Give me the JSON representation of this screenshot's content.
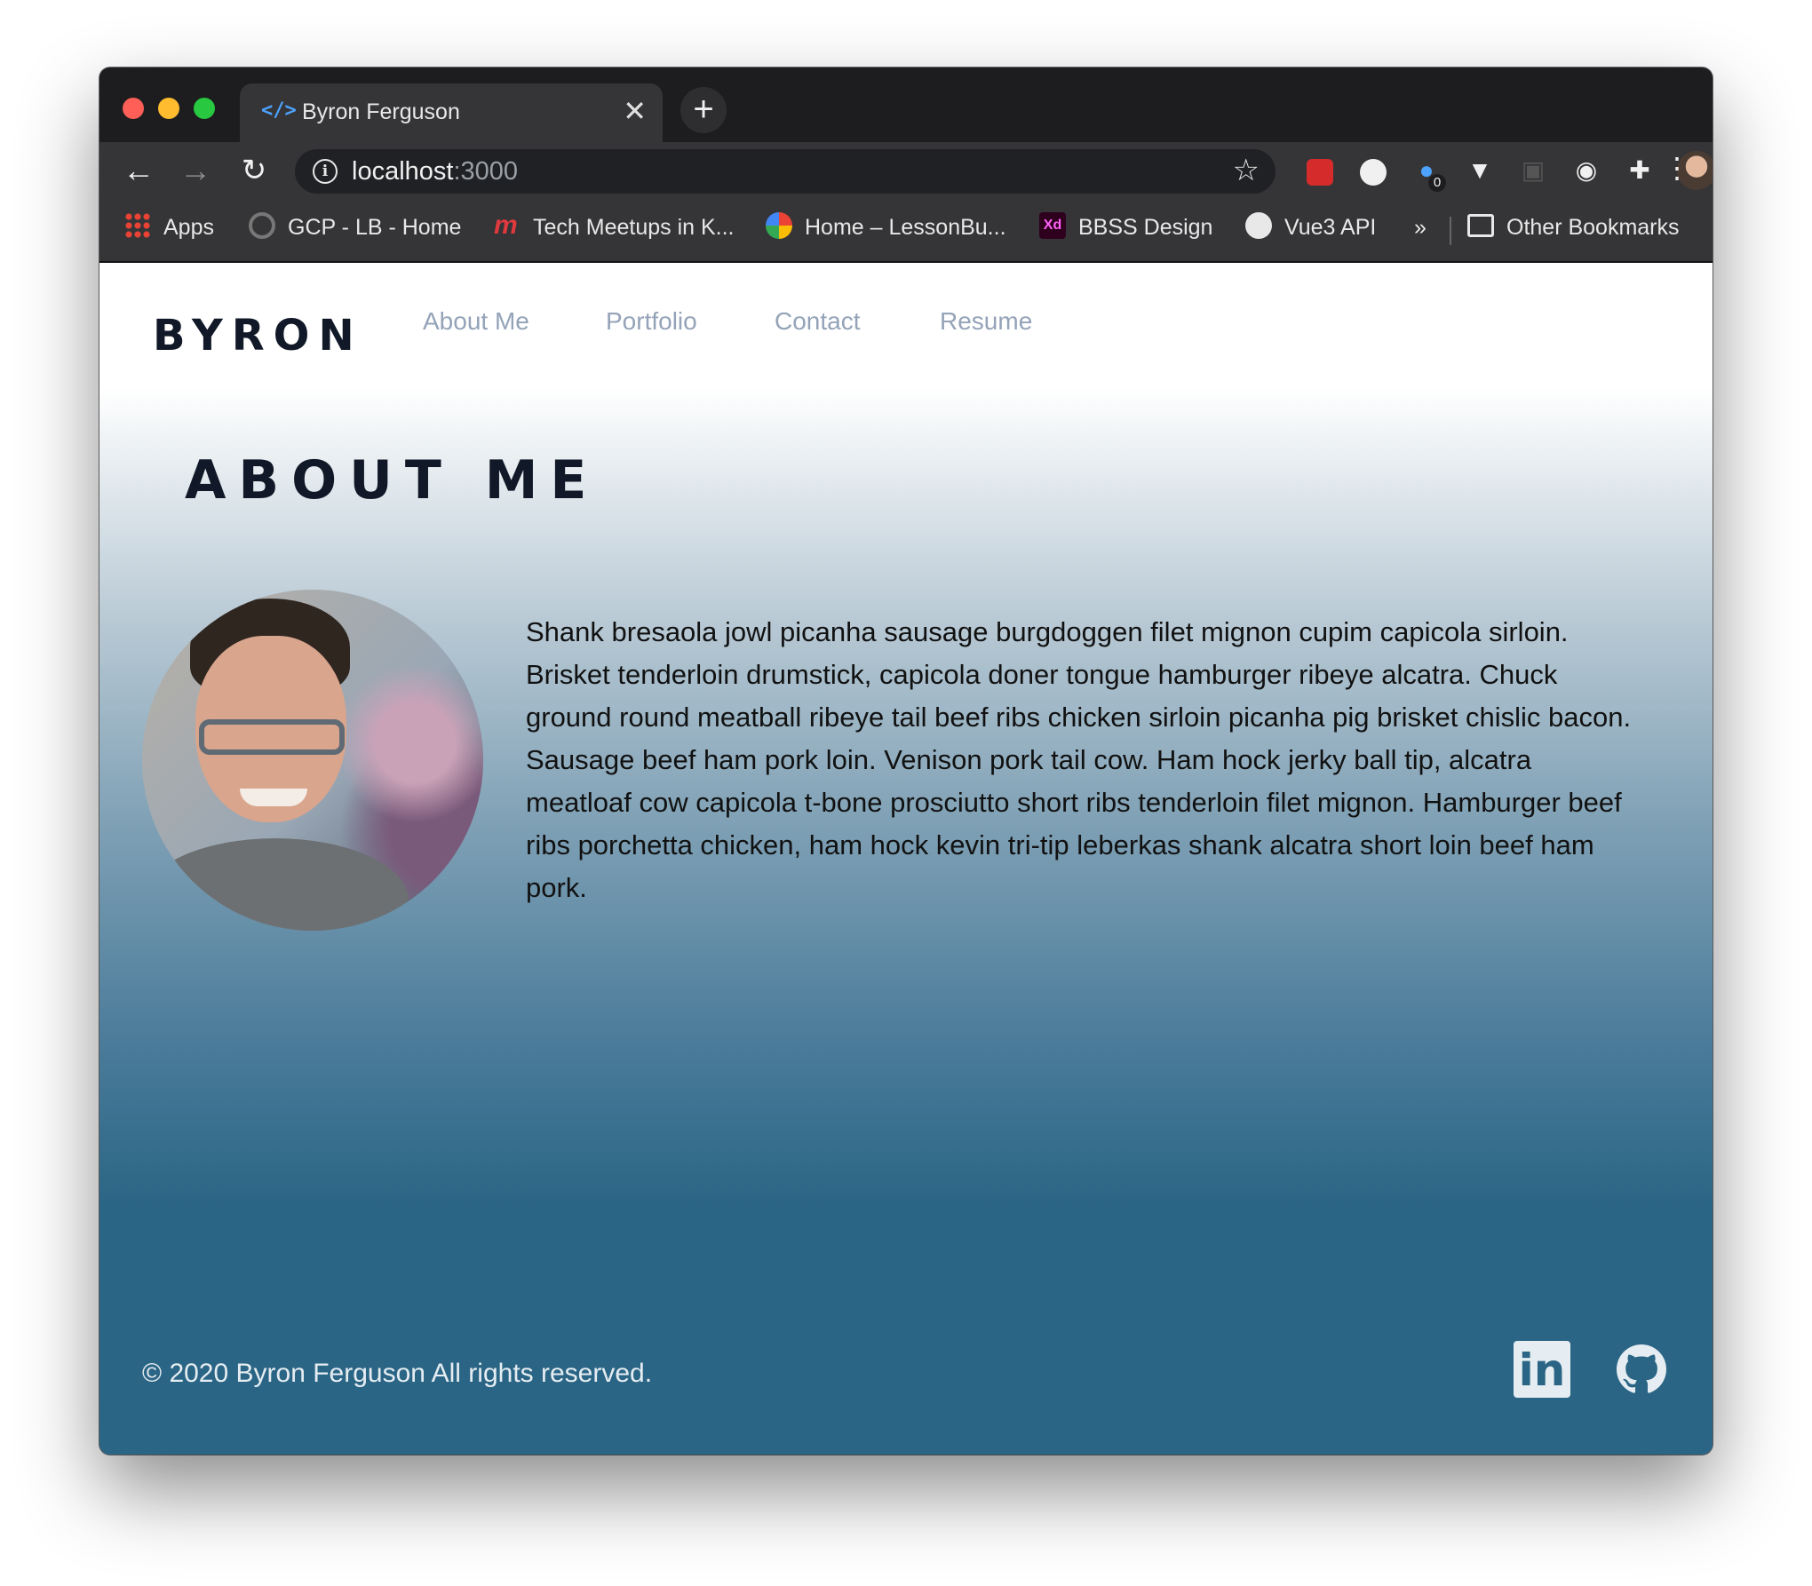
{
  "browser": {
    "tab_title": "Byron Ferguson",
    "new_tab_label": "+",
    "close_tab_label": "✕",
    "url_host": "localhost",
    "url_port": ":3000",
    "extension_badge": "0",
    "bookmarks": [
      {
        "label": "Apps",
        "icon": "apps-grid-icon"
      },
      {
        "label": "GCP - LB - Home",
        "icon": "gcp-icon"
      },
      {
        "label": "Tech Meetups in K...",
        "icon": "meetup-icon"
      },
      {
        "label": "Home – LessonBu...",
        "icon": "google-icon"
      },
      {
        "label": "BBSS Design",
        "icon": "adobe-xd-icon"
      },
      {
        "label": "Vue3 API",
        "icon": "globe-icon"
      }
    ],
    "bookmarks_overflow": "»",
    "other_bookmarks": "Other Bookmarks"
  },
  "site": {
    "logo": "BYRON",
    "nav": [
      "About Me",
      "Portfolio",
      "Contact",
      "Resume"
    ],
    "heading": "ABOUT ME",
    "bio": "Shank bresaola jowl picanha sausage burgdoggen filet mignon cupim capicola sirloin. Brisket tenderloin drumstick, capicola doner tongue hamburger ribeye alcatra. Chuck ground round meatball ribeye tail beef ribs chicken sirloin picanha pig brisket chislic bacon. Sausage beef ham pork loin. Venison pork tail cow. Ham hock jerky ball tip, alcatra meatloaf cow capicola t-bone prosciutto short ribs tenderloin filet mignon. Hamburger beef ribs porchetta chicken, ham hock kevin tri-tip leberkas shank alcatra short loin beef ham pork.",
    "footer": "© 2020 Byron Ferguson All rights reserved.",
    "linkedin_label": "in"
  },
  "colors": {
    "footer_bg": "#2b6585",
    "nav_link": "#94a3b8",
    "heading": "#111827"
  }
}
